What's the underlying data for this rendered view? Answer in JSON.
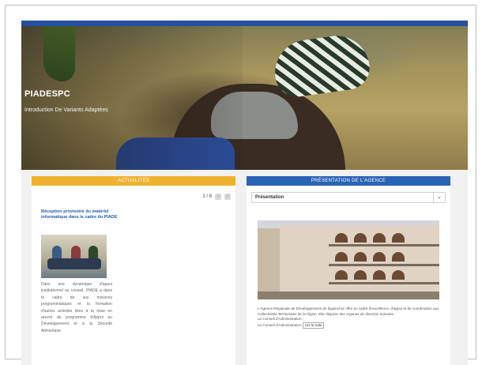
{
  "hero": {
    "title": "PIADESPC",
    "subtitle": "Introduction De Variants Adaptées"
  },
  "news": {
    "header": "ACTUALITÉS",
    "pager_text": "1 / 8",
    "pager_prev": "‹",
    "pager_next": "›",
    "title": "Réception provisoire du matériel informatique dans le cadre du PIADE",
    "body": "Dans une dynamique d'appui institutionnel au conseil, PIADE a dans le cadre de ses missions programmatiques et la formation d'autres activités liées à la mise en œuvre du programme d'Appui au Développement et à la Sécurité Alimentaire"
  },
  "agency": {
    "header": "PRÉSENTATION DE L'AGENCE",
    "select_label": "Présentation",
    "chevron": "⌄",
    "description": "L'Agence Régionale de Développement de Ziguinchor offre un cadre d'excellence, d'appui et de coordination aux Collectivités Territoriales de la région. Elle dispose des organes de direction suivants :",
    "bullets": [
      "Le Conseil d'Administration ;",
      "Le Conseil d'Administration"
    ],
    "more_label": "Lire la suite"
  }
}
